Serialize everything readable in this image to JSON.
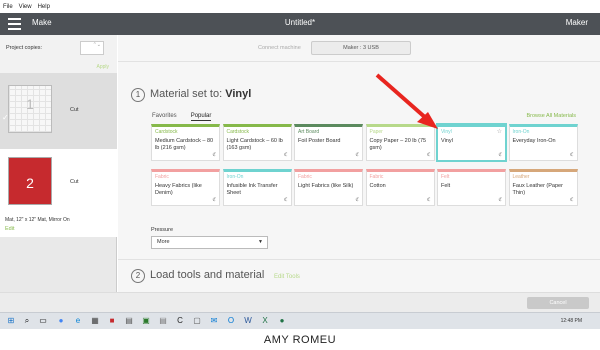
{
  "menubar": {
    "items": [
      "File",
      "View",
      "Help"
    ]
  },
  "appbar": {
    "left_title": "Make",
    "center_title": "Untitled*",
    "right_title": "Maker"
  },
  "left_panel": {
    "copies_label": "Project copies:",
    "apply_label": "Apply",
    "mats": [
      {
        "number": "1",
        "action": "Cut"
      },
      {
        "number": "2",
        "action": "Cut",
        "info": "Mat, 12\" x 12\" Mat, Mirror On",
        "edit": "Edit"
      }
    ]
  },
  "main": {
    "connect_label": "Connect machine",
    "connect_value": "Maker : 3 USB",
    "step1": {
      "number": "1",
      "prefix": "Material set to:",
      "value": "Vinyl"
    },
    "tabs": [
      "Favorites",
      "Popular"
    ],
    "active_tab": "Popular",
    "browse_label": "Browse All Materials",
    "materials": [
      {
        "category": "Cardstock",
        "name": "Medium Cardstock – 80 lb (216 gsm)",
        "color": "#86b94a"
      },
      {
        "category": "Cardstock",
        "name": "Light Cardstock – 60 lb (163 gsm)",
        "color": "#86b94a"
      },
      {
        "category": "Art Board",
        "name": "Foil Poster Board",
        "color": "#5b8a5e"
      },
      {
        "category": "Paper",
        "name": "Copy Paper – 20 lb (75 gsm)",
        "color": "#b7d98a"
      },
      {
        "category": "Vinyl",
        "name": "Vinyl",
        "color": "#6fd3d0",
        "selected": true
      },
      {
        "category": "Iron-On",
        "name": "Everyday Iron-On",
        "color": "#6fd3d0"
      },
      {
        "category": "Fabric",
        "name": "Heavy Fabrics (like Denim)",
        "color": "#f2a0a0"
      },
      {
        "category": "Iron-On",
        "name": "Infusible Ink Transfer Sheet",
        "color": "#6fd3d0"
      },
      {
        "category": "Fabric",
        "name": "Light Fabrics (like Silk)",
        "color": "#f2a0a0"
      },
      {
        "category": "Fabric",
        "name": "Cotton",
        "color": "#f2a0a0"
      },
      {
        "category": "Felt",
        "name": "Felt",
        "color": "#f2a0a0"
      },
      {
        "category": "Leather",
        "name": "Faux Leather (Paper Thin)",
        "color": "#d6a77a"
      }
    ],
    "pressure_label": "Pressure",
    "pressure_value": "More",
    "step2": {
      "number": "2",
      "title": "Load tools and material",
      "edit_tools": "Edit Tools"
    }
  },
  "bottom": {
    "cancel_label": "Cancel"
  },
  "taskbar": {
    "time": "12:48 PM"
  },
  "footer": {
    "credit": "AMY ROMEU"
  },
  "colors": {
    "accent_green": "#86b94a",
    "arrow_red": "#e8251f",
    "appbar": "#4d5156"
  }
}
